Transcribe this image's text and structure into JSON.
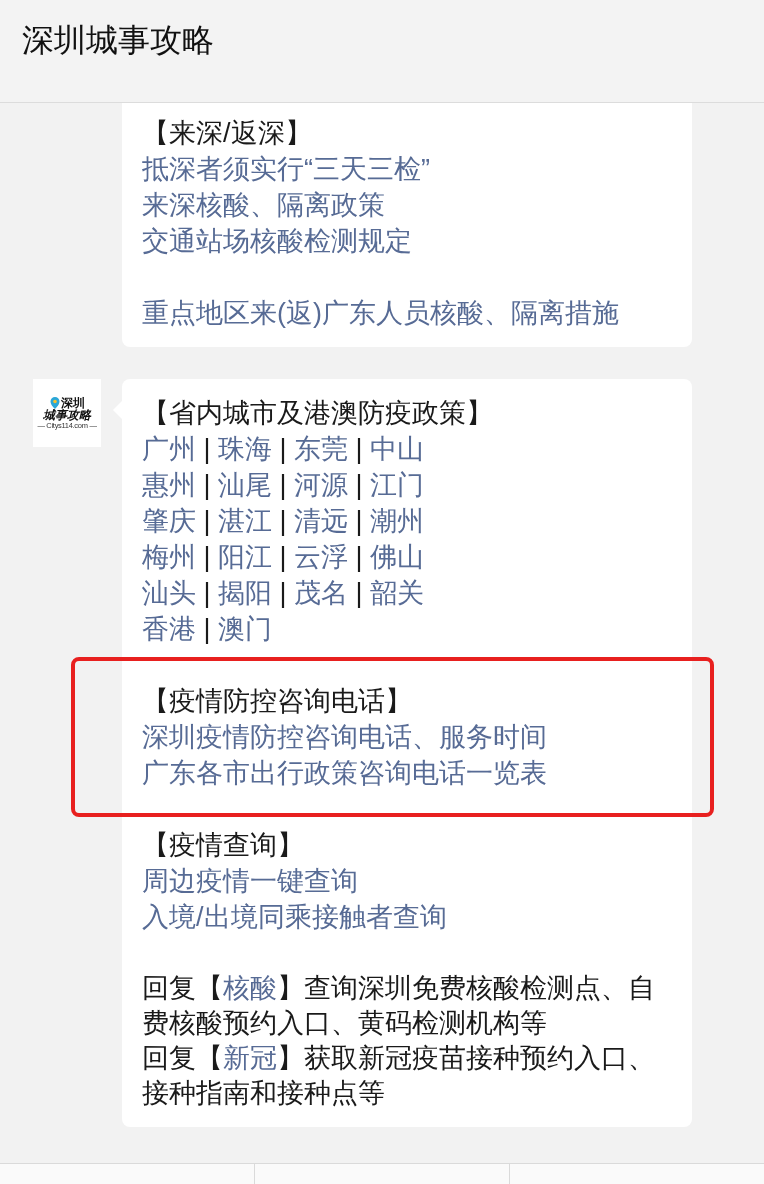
{
  "header": {
    "title": "深圳城事攻略"
  },
  "messages": [
    {
      "sections": [
        {
          "highlighted": false,
          "lines": [
            {
              "kind": "heading",
              "segments": [
                {
                  "text": "【来深/返深】",
                  "link": false
                }
              ]
            },
            {
              "kind": "link",
              "segments": [
                {
                  "text": "抵深者须实行“三天三检”",
                  "link": true
                }
              ]
            },
            {
              "kind": "link",
              "segments": [
                {
                  "text": "来深核酸、隔离政策",
                  "link": true
                }
              ]
            },
            {
              "kind": "link",
              "segments": [
                {
                  "text": "交通站场核酸检测规定",
                  "link": true
                }
              ]
            }
          ]
        },
        {
          "highlighted": false,
          "lines": [
            {
              "kind": "link",
              "segments": [
                {
                  "text": "重点地区来(返)广东人员核酸、隔离措施",
                  "link": true
                }
              ]
            }
          ]
        }
      ]
    },
    {
      "avatar": {
        "line1": "深圳",
        "line2": "城事攻略",
        "line3": "— Citys114.com —"
      },
      "sections": [
        {
          "highlighted": false,
          "lines": [
            {
              "kind": "heading",
              "segments": [
                {
                  "text": "【省内城市及港澳防疫政策】",
                  "link": false
                }
              ]
            },
            {
              "kind": "cities",
              "segments": [
                {
                  "text": "广州",
                  "link": true
                },
                {
                  "text": " | ",
                  "link": false
                },
                {
                  "text": "珠海",
                  "link": true
                },
                {
                  "text": " | ",
                  "link": false
                },
                {
                  "text": "东莞",
                  "link": true
                },
                {
                  "text": " | ",
                  "link": false
                },
                {
                  "text": "中山",
                  "link": true
                }
              ]
            },
            {
              "kind": "cities",
              "segments": [
                {
                  "text": "惠州",
                  "link": true
                },
                {
                  "text": " | ",
                  "link": false
                },
                {
                  "text": "汕尾",
                  "link": true
                },
                {
                  "text": " | ",
                  "link": false
                },
                {
                  "text": "河源",
                  "link": true
                },
                {
                  "text": " | ",
                  "link": false
                },
                {
                  "text": "江门",
                  "link": true
                }
              ]
            },
            {
              "kind": "cities",
              "segments": [
                {
                  "text": "肇庆",
                  "link": true
                },
                {
                  "text": " | ",
                  "link": false
                },
                {
                  "text": "湛江",
                  "link": true
                },
                {
                  "text": " | ",
                  "link": false
                },
                {
                  "text": "清远",
                  "link": true
                },
                {
                  "text": " | ",
                  "link": false
                },
                {
                  "text": "潮州",
                  "link": true
                }
              ]
            },
            {
              "kind": "cities",
              "segments": [
                {
                  "text": "梅州",
                  "link": true
                },
                {
                  "text": " | ",
                  "link": false
                },
                {
                  "text": "阳江",
                  "link": true
                },
                {
                  "text": " | ",
                  "link": false
                },
                {
                  "text": "云浮",
                  "link": true
                },
                {
                  "text": " | ",
                  "link": false
                },
                {
                  "text": "佛山",
                  "link": true
                }
              ]
            },
            {
              "kind": "cities",
              "segments": [
                {
                  "text": "汕头",
                  "link": true
                },
                {
                  "text": " | ",
                  "link": false
                },
                {
                  "text": "揭阳",
                  "link": true
                },
                {
                  "text": " | ",
                  "link": false
                },
                {
                  "text": "茂名",
                  "link": true
                },
                {
                  "text": " | ",
                  "link": false
                },
                {
                  "text": "韶关",
                  "link": true
                }
              ]
            },
            {
              "kind": "cities",
              "segments": [
                {
                  "text": "香港",
                  "link": true
                },
                {
                  "text": " | ",
                  "link": false
                },
                {
                  "text": "澳门",
                  "link": true
                }
              ]
            }
          ]
        },
        {
          "highlighted": true,
          "lines": [
            {
              "kind": "heading",
              "segments": [
                {
                  "text": "【疫情防控咨询电话】",
                  "link": false
                }
              ]
            },
            {
              "kind": "link",
              "segments": [
                {
                  "text": "深圳疫情防控咨询电话、服务时间",
                  "link": true
                }
              ]
            },
            {
              "kind": "link",
              "segments": [
                {
                  "text": "广东各市出行政策咨询电话一览表",
                  "link": true
                }
              ]
            }
          ]
        },
        {
          "highlighted": false,
          "lines": [
            {
              "kind": "heading",
              "segments": [
                {
                  "text": "【疫情查询】",
                  "link": false
                }
              ]
            },
            {
              "kind": "link",
              "segments": [
                {
                  "text": "周边疫情一键查询",
                  "link": true
                }
              ]
            },
            {
              "kind": "link",
              "segments": [
                {
                  "text": "入境/出境同乘接触者查询",
                  "link": true
                }
              ]
            }
          ]
        },
        {
          "highlighted": false,
          "lines": [
            {
              "kind": "paragraph",
              "segments": [
                {
                  "text": "回复【",
                  "link": false
                },
                {
                  "text": "核酸",
                  "link": true
                },
                {
                  "text": "】查询深圳免费核酸检测点、自费核酸预约入口、黄码检测机构等",
                  "link": false
                }
              ]
            },
            {
              "kind": "paragraph",
              "segments": [
                {
                  "text": "回复【",
                  "link": false
                },
                {
                  "text": "新冠",
                  "link": true
                },
                {
                  "text": "】获取新冠疫苗接种预约入口、接种指南和接种点等",
                  "link": false
                }
              ]
            }
          ]
        }
      ]
    }
  ]
}
